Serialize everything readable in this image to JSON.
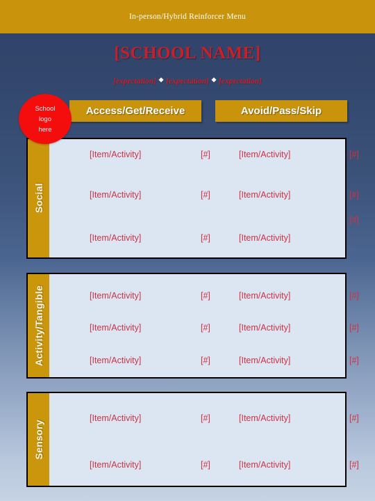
{
  "banner": {
    "title": "In-person/Hybrid Reinforcer Menu"
  },
  "heading": {
    "school_name": "[SCHOOL NAME]",
    "expectation_1": "[expectation]",
    "expectation_2": "[expectation]",
    "expectation_3": "[expectation]",
    "separator": "❖"
  },
  "logo": {
    "line1": "School",
    "line2": "logo",
    "line3": "here"
  },
  "columns": {
    "access": "Access/Get/Receive",
    "avoid": "Avoid/Pass/Skip"
  },
  "colors": {
    "gold": "#c9930c",
    "red": "#c8202a",
    "panel_bg": "#dce5f2",
    "logo_red": "#f40d0d",
    "cell_text": "#cc3344",
    "background_top": "#2f4268",
    "background_bottom": "#c6d3e4"
  },
  "sections": [
    {
      "label": "Social",
      "rows": [
        {
          "item": "[Item/Activity]",
          "num": "[#]",
          "item2": "[Item/Activity]",
          "num2": "[#]"
        },
        {
          "item": "[Item/Activity]",
          "num": "[#]",
          "item2": "[Item/Activity]",
          "num2": "[#]"
        },
        {
          "item": "[Item/Activity]",
          "num": "[#]",
          "item2": "[Item/Activity]",
          "num2": "[#]"
        }
      ]
    },
    {
      "label": "Activity/Tangible",
      "rows": [
        {
          "item": "[Item/Activity]",
          "num": "[#]",
          "item2": "[Item/Activity]",
          "num2": "[#]"
        },
        {
          "item": "[Item/Activity]",
          "num": "[#]",
          "item2": "[Item/Activity]",
          "num2": "[#]"
        },
        {
          "item": "[Item/Activity]",
          "num": "[#]",
          "item2": "[Item/Activity]",
          "num2": "[#]"
        }
      ]
    },
    {
      "label": "Sensory",
      "rows": [
        {
          "item": "[Item/Activity]",
          "num": "[#]",
          "item2": "[Item/Activity]",
          "num2": "[#]"
        },
        {
          "item": "[Item/Activity]",
          "num": "[#]",
          "item2": "[Item/Activity]",
          "num2": "[#]"
        }
      ]
    }
  ]
}
